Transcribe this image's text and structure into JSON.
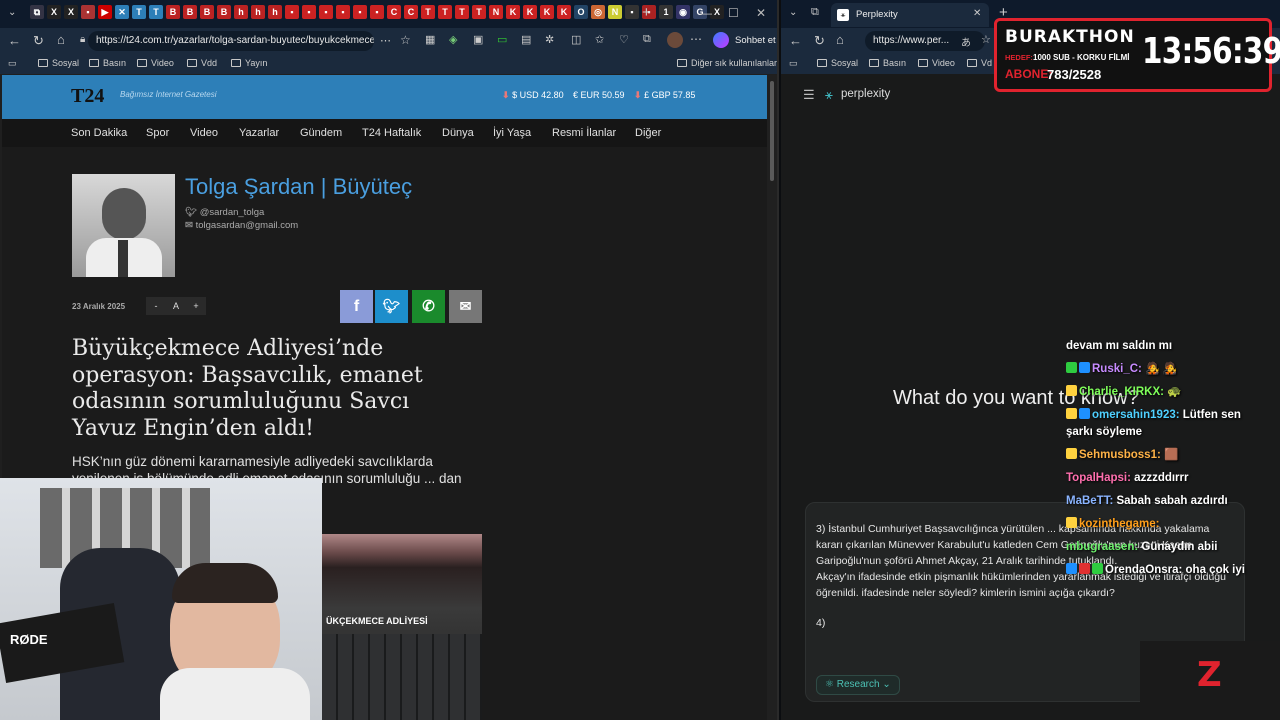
{
  "left_browser": {
    "tab_title": "T24",
    "url": "https://t24.com.tr/yazarlar/tolga-sardan-buyutec/buyukcekmece...",
    "sidebar_chat_label": "Sohbet et",
    "bookmarks": [
      "Sosyal",
      "Basın",
      "Video",
      "Vdd",
      "Yayın"
    ],
    "other_bookmarks": "Diğer sık kullanılanlar"
  },
  "t24": {
    "logo": "T24",
    "slogan": "Bağımsız İnternet Gazetesi",
    "currency": [
      {
        "label": "$ USD 42.80"
      },
      {
        "label": "€ EUR 50.59"
      },
      {
        "label": "£ GBP 57.85"
      }
    ],
    "nav": [
      "Son Dakika",
      "Spor",
      "Video",
      "Yazarlar",
      "Gündem",
      "T24 Haftalık",
      "Dünya",
      "İyi Yaşa",
      "Resmi İlanlar",
      "Diğer"
    ],
    "author": {
      "name": "Tolga Şardan | Büyüteç",
      "twitter": "@sardan_tolga",
      "email": "tolgasardan@gmail.com"
    },
    "date": "23 Aralık 2025",
    "font_controls": {
      "minus": "-",
      "a": "A",
      "plus": "+"
    },
    "headline": "Büyükçekmece Adliyesi’nde operasyon: Başsavcılık, emanet odasının sorumluluğunu Savcı Yavuz Engin’den aldı!",
    "lead": "HSK’nın güz dönemi kararnamesiyle adliyedeki savcılıklarda yenilenen iş bölümünde adli emanet odasının sorumluluğu ... dan Talimat Bürosu",
    "image_sign": "ÜKÇEKMECE ADLİYESİ"
  },
  "right_browser": {
    "tab_title": "Perplexity",
    "url": "https://www.per...",
    "bookmarks": [
      "Sosyal",
      "Basın",
      "Video",
      "Vd"
    ],
    "brand": "perplexity",
    "hero": "What do you want to know?",
    "prompt_lines": [
      "3) İstanbul Cumhuriyet Başsavcılığınca yürütülen ... kapsamında hakkında yakalama kararı çıkarılan Münevver Karabulut'u katleden Cem Garipoğlu'nun kuzeni Kasım Garipoğlu'nun şoförü Ahmet Akçay, 21 Aralık tarihinde tutuklandı.",
      "Akçay'ın ifadesinde etkin pişmanlık hükümlerinden yararlanmak istediği ve itirafçı olduğu öğrenildi. ifadesinde neler söyledi? kimlerin ismini açığa çıkardı?",
      "4)"
    ],
    "research_label": "Research"
  },
  "stream": {
    "title": "BURAKTHON",
    "hedef_label": "HEDEF:",
    "hedef": "1000 SUB - KORKU FİLMİ",
    "abone_label": "ABONE:",
    "abone": "783/2528",
    "timer": "13:56:39",
    "chat": [
      {
        "user": "",
        "text": "devam mı saldın mı",
        "color": "#ffffff"
      },
      {
        "user": "Ruski_C:",
        "text": "🧑‍🎤 🧑‍🎤",
        "color": "#c78bff"
      },
      {
        "user": "Charlie_KIRKX:",
        "text": "🐢",
        "color": "#7fff5a"
      },
      {
        "user": "omersahin1923:",
        "text": "Lütfen sen şarkı söyleme",
        "color": "#4fd0ff"
      },
      {
        "user": "Sehmusboss1:",
        "text": "🟫",
        "color": "#ffb347"
      },
      {
        "user": "TopalHapsi:",
        "text": "azzzddırrr",
        "color": "#ff6fae"
      },
      {
        "user": "MaBeTT:",
        "text": "Sabah sabah azdırdı",
        "color": "#8ab4ff"
      },
      {
        "user": "kozinthegame:",
        "text": "",
        "color": "#ff9f1a"
      },
      {
        "user": "",
        "text": "",
        "color": "#ff6060"
      },
      {
        "user": "mbugraasen:",
        "text": "Günaydın abii",
        "color": "#6cf06c"
      },
      {
        "user": "OrendaOnsra:",
        "text": "oha çok iyi",
        "color": "#ffffff"
      }
    ],
    "mic_brand": "RØDE"
  },
  "colors": {
    "t24_blue": "#2d7fb8",
    "counter_red": "#e0232e",
    "twitter": "#1da1f2",
    "whatsapp": "#25a244",
    "facebook": "#8a9bd8"
  }
}
